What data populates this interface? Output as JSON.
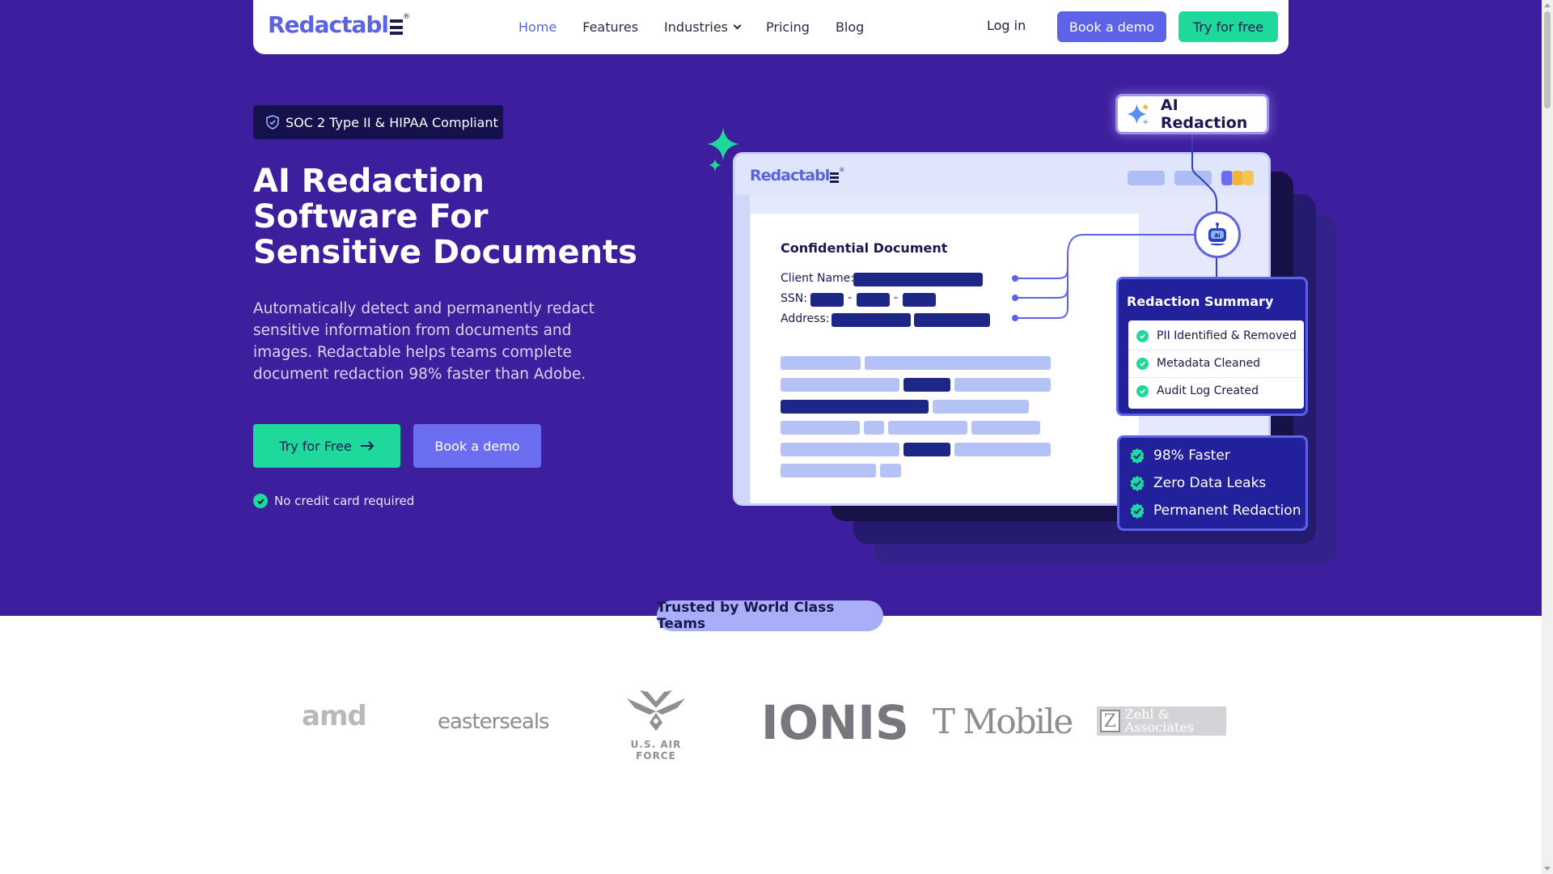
{
  "nav": {
    "logo": "Redactabl",
    "logo_mark": "®",
    "links": [
      "Home",
      "Features",
      "Industries",
      "Pricing",
      "Blog"
    ],
    "login": "Log in",
    "demo_button": "Book a demo",
    "try_button": "Try for free"
  },
  "hero": {
    "badge": "SOC 2 Type II & HIPAA Compliant",
    "headline": "AI Redaction Software For Sensitive Documents",
    "subtext": "Automatically detect and permanently redact sensitive information from documents and images. Redactable helps teams complete document redaction 98% faster than Adobe.",
    "try_button": "Try for Free",
    "demo_button": "Book a demo",
    "no_cc": "No credit card required"
  },
  "illustration": {
    "ai_tag": "AI Redaction",
    "doc_logo": "Redactabl",
    "doc_title": "Confidential Document",
    "fields": [
      "Client Name:",
      "SSN:",
      "Address:"
    ],
    "ssn_dash": "-",
    "robot_label": "AI",
    "summary": {
      "title": "Redaction Summary",
      "items": [
        "PII Identified & Removed",
        "Metadata Cleaned",
        "Audit Log Created"
      ]
    },
    "stats": [
      "98% Faster",
      "Zero Data Leaks",
      "Permanent Redaction"
    ]
  },
  "trusted": {
    "label": "Trusted by World Class Teams",
    "logos": [
      "amd",
      "easterseals",
      "U.S. AIR FORCE",
      "IONIS",
      "T Mobile",
      "Zehl & Associates"
    ]
  },
  "colors": {
    "hero_bg": "#3d1f9e",
    "accent": "#5c63e8",
    "green": "#1fd89b",
    "navy": "#14114d"
  }
}
